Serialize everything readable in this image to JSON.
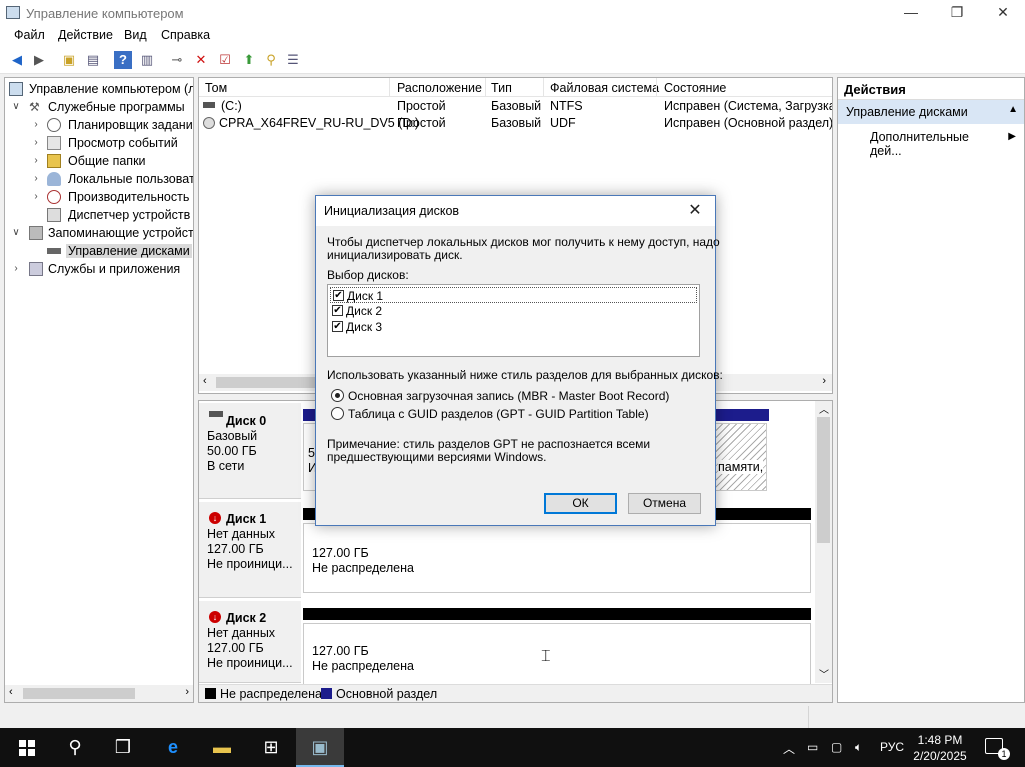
{
  "window": {
    "title": "Управление компьютером",
    "controls": {
      "minimize": "—",
      "maximize": "❐",
      "close": "✕"
    }
  },
  "menu": [
    "Файл",
    "Действие",
    "Вид",
    "Справка"
  ],
  "toolbar_icons": [
    "back-arrow-icon",
    "forward-arrow-icon",
    "up-folder-icon",
    "show-hide-tree-icon",
    "help-icon",
    "properties-icon",
    "connect-icon",
    "delete-icon",
    "check-icon",
    "export-icon",
    "search-icon",
    "settings-icon"
  ],
  "tree": {
    "items": [
      {
        "label": "Управление компьютером (л",
        "level": 0,
        "chev": ""
      },
      {
        "label": "Служебные программы",
        "level": 1,
        "chev": "∨"
      },
      {
        "label": "Планировщик заданий",
        "level": 2,
        "chev": "›"
      },
      {
        "label": "Просмотр событий",
        "level": 2,
        "chev": "›"
      },
      {
        "label": "Общие папки",
        "level": 2,
        "chev": "›"
      },
      {
        "label": "Локальные пользовате",
        "level": 2,
        "chev": "›"
      },
      {
        "label": "Производительность",
        "level": 2,
        "chev": "›"
      },
      {
        "label": "Диспетчер устройств",
        "level": 2,
        "chev": ""
      },
      {
        "label": "Запоминающие устройст",
        "level": 1,
        "chev": "∨"
      },
      {
        "label": "Управление дисками",
        "level": 2,
        "chev": ""
      },
      {
        "label": "Службы и приложения",
        "level": 1,
        "chev": "›"
      }
    ]
  },
  "volumes": {
    "headers": [
      "Том",
      "Расположение",
      "Тип",
      "Файловая система",
      "Состояние"
    ],
    "rows": [
      [
        "(C:)",
        "Простой",
        "Базовый",
        "NTFS",
        "Исправен (Система, Загрузка, Ф"
      ],
      [
        "CPRA_X64FREV_RU-RU_DV5 (D:)",
        "Простой",
        "Базовый",
        "UDF",
        "Исправен (Основной раздел)"
      ]
    ]
  },
  "disks": [
    {
      "name": "Диск 0",
      "type": "Базовый",
      "size": "50.00 ГБ",
      "status": "В сети",
      "partial_left": "5",
      "partial_left2": "И",
      "partial_right": "памяти,"
    },
    {
      "name": "Диск 1",
      "type": "Нет данных",
      "size": "127.00 ГБ",
      "status": "Не проиници...",
      "part_size": "127.00 ГБ",
      "part_state": "Не распределена"
    },
    {
      "name": "Диск 2",
      "type": "Нет данных",
      "size": "127.00 ГБ",
      "status": "Не проиници...",
      "part_size": "127.00 ГБ",
      "part_state": "Не распределена"
    }
  ],
  "legend": [
    {
      "label": "Не распределена",
      "color": "#000000"
    },
    {
      "label": "Основной раздел",
      "color": "#1c1c8c"
    }
  ],
  "actions": {
    "title": "Действия",
    "selected": "Управление дисками",
    "item": "Дополнительные дей..."
  },
  "dialog": {
    "title": "Инициализация дисков",
    "desc_line1": "Чтобы диспетчер локальных дисков мог получить к нему доступ, надо",
    "desc_line2": "инициализировать диск.",
    "select_label": "Выбор дисков:",
    "disks": [
      "Диск 1",
      "Диск 2",
      "Диск 3"
    ],
    "style_label": "Использовать указанный ниже стиль разделов для выбранных дисков:",
    "options": [
      {
        "label": "Основная загрузочная запись (MBR - Master Boot Record)",
        "selected": true
      },
      {
        "label": "Таблица с GUID разделов (GPT - GUID Partition Table)",
        "selected": false
      }
    ],
    "note_line1": "Примечание: стиль разделов GPT не распознается всеми",
    "note_line2": "предшествующими версиями Windows.",
    "ok": "ОК",
    "cancel": "Отмена"
  },
  "taskbar": {
    "lang": "РУС",
    "time": "1:48 PM",
    "date": "2/20/2025",
    "notifications": "1"
  },
  "colors": {
    "accent": "#0078d7",
    "primary_partition": "#1c1c8c",
    "selection": "#d9e6f5"
  }
}
